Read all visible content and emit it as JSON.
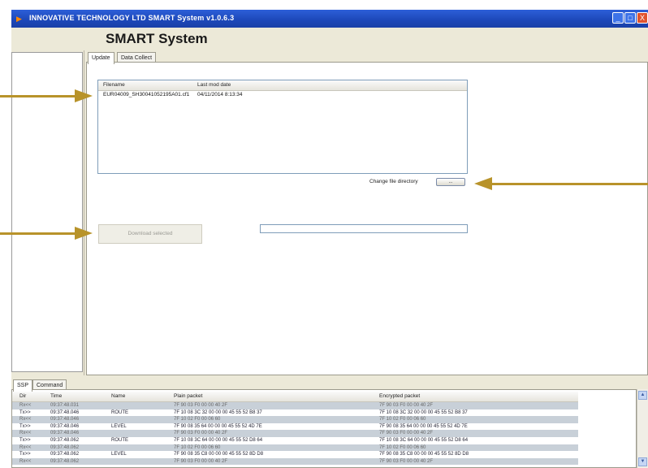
{
  "window": {
    "title": "INNOVATIVE TECHNOLOGY LTD   SMART System   v1.0.6.3",
    "controls": {
      "minimize": "_",
      "maximize": "□",
      "close": "X"
    }
  },
  "header": {
    "title": "SMART System"
  },
  "tabs": [
    {
      "label": "Update",
      "active": true
    },
    {
      "label": "Data Collect",
      "active": false
    }
  ],
  "file_list": {
    "columns": [
      "Filename",
      "Last mod date"
    ],
    "rows": [
      {
        "filename": "EUR04009_SH30041052195A01.cf1",
        "date": "04/11/2014 8:13:34"
      }
    ]
  },
  "change_dir": {
    "label": "Change file directory",
    "button": "..."
  },
  "download_button": {
    "label": "Download selected"
  },
  "log": {
    "tabs": [
      {
        "label": "SSP",
        "active": true
      },
      {
        "label": "Command",
        "active": false
      }
    ],
    "columns": [
      "Dir",
      "Time",
      "Name",
      "Plain packet",
      "Encrypted packet"
    ],
    "rows": [
      {
        "dir": "Rx<<",
        "time": "09:37:48.031",
        "name": "",
        "plain": "7F 90 03 F0 00 00 40 2F",
        "encrypted": "7F 90 03 F0 00 00 40 2F"
      },
      {
        "dir": "Tx>>",
        "time": "09:37:48.046",
        "name": "ROUTE",
        "plain": "7F 10 08 3C 32 00 00 00 45 55 52 B8 37",
        "encrypted": "7F 10 08 3C 32 00 00 00 45 55 52 B8 37"
      },
      {
        "dir": "Rx<<",
        "time": "09:37:48.046",
        "name": "",
        "plain": "7F 10 02 F0 00 06 60",
        "encrypted": "7F 10 02 F0 00 06 60"
      },
      {
        "dir": "Tx>>",
        "time": "09:37:48.046",
        "name": "LEVEL",
        "plain": "7F 90 08 35 64 00 00 00 45 55 52 4D 7E",
        "encrypted": "7F 90 08 35 64 00 00 00 45 55 52 4D 7E"
      },
      {
        "dir": "Rx<<",
        "time": "09:37:48.046",
        "name": "",
        "plain": "7F 90 03 F0 00 00 40 2F",
        "encrypted": "7F 90 03 F0 00 00 40 2F"
      },
      {
        "dir": "Tx>>",
        "time": "09:37:48.062",
        "name": "ROUTE",
        "plain": "7F 10 08 3C 64 00 00 00 45 55 52 D8 64",
        "encrypted": "7F 10 08 3C 64 00 00 00 45 55 52 D8 64"
      },
      {
        "dir": "Rx<<",
        "time": "09:37:48.062",
        "name": "",
        "plain": "7F 10 02 F0 00 06 60",
        "encrypted": "7F 10 02 F0 00 06 60"
      },
      {
        "dir": "Tx>>",
        "time": "09:37:48.062",
        "name": "LEVEL",
        "plain": "7F 90 08 35 C8 00 00 00 45 55 52 8D D8",
        "encrypted": "7F 90 08 35 C8 00 00 00 45 55 52 8D D8"
      },
      {
        "dir": "Rx<<",
        "time": "09:37:48.062",
        "name": "",
        "plain": "7F 90 03 F0 00 00 40 2F",
        "encrypted": "7F 90 03 F0 00 00 40 2F"
      }
    ]
  },
  "colors": {
    "titlebar": "#1c47b8",
    "arrow": "#b8932a",
    "rx_row": "#c8d0d8"
  }
}
